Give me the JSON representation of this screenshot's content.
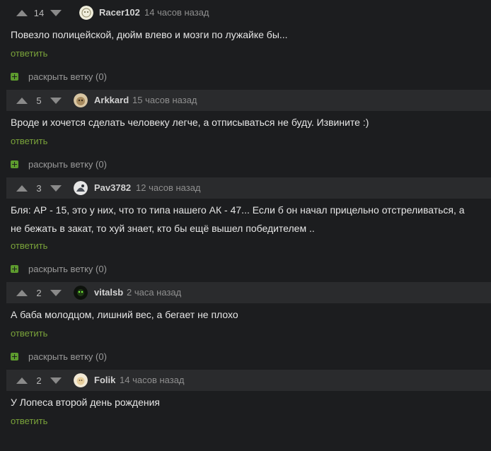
{
  "comments": [
    {
      "votes": "14",
      "user": "Racer102",
      "time": "14 часов назад",
      "lines": [
        "Повезло полицейской, дюйм влево и мозги по лужайке бы..."
      ],
      "reply": "ответить",
      "expand": "раскрыть ветку (0)"
    },
    {
      "votes": "5",
      "user": "Arkkard",
      "time": "15 часов назад",
      "lines": [
        "Вроде и хочется сделать человеку легче, а отписываться не буду. Извините :)"
      ],
      "reply": "ответить",
      "expand": "раскрыть ветку (0)"
    },
    {
      "votes": "3",
      "user": "Pav3782",
      "time": "12 часов назад",
      "lines": [
        "Бля: АР - 15, это у них, что то типа нашего АК - 47... Если б он начал прицельно отстреливаться, а",
        "не бежать в закат, то хуй знает, кто бы ещё вышел победителем .."
      ],
      "reply": "ответить",
      "expand": "раскрыть ветку (0)"
    },
    {
      "votes": "2",
      "user": "vitalsb",
      "time": "2 часа назад",
      "lines": [
        "А баба молодцом, лишний вес, а бегает не плохо"
      ],
      "reply": "ответить",
      "expand": "раскрыть ветку (0)"
    },
    {
      "votes": "2",
      "user": "Folik",
      "time": "14 часов назад",
      "lines": [
        "У Лопеса второй день рождения"
      ],
      "reply": "ответить"
    }
  ],
  "icons": {
    "upvote": "arrow-up-icon",
    "downvote": "arrow-down-icon",
    "expand": "plus-icon"
  },
  "colors": {
    "background": "#1c1d1f",
    "header_bar": "#2a2b2d",
    "reply_link": "#7aa33a",
    "expand_icon": "#5d9b2e",
    "time_text": "#8f8f8f"
  }
}
